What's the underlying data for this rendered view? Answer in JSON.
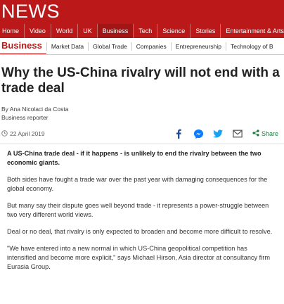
{
  "brand": {
    "logo_text": "NEWS",
    "color": "#bb1919"
  },
  "nav": {
    "items": [
      {
        "label": "Home"
      },
      {
        "label": "Video"
      },
      {
        "label": "World"
      },
      {
        "label": "UK"
      },
      {
        "label": "Business",
        "active": true
      },
      {
        "label": "Tech"
      },
      {
        "label": "Science"
      },
      {
        "label": "Stories"
      },
      {
        "label": "Entertainment & Arts"
      }
    ]
  },
  "subnav": {
    "section": "Business",
    "items": [
      {
        "label": "Market Data"
      },
      {
        "label": "Global Trade"
      },
      {
        "label": "Companies"
      },
      {
        "label": "Entrepreneurship"
      },
      {
        "label": "Technology of B"
      }
    ]
  },
  "article": {
    "headline": "Why the US-China rivalry will not end with a trade deal",
    "author": "By Ana Nicolaci da Costa",
    "role": "Business reporter",
    "date": "22 April 2019",
    "share_label": "Share",
    "share_icons": [
      "facebook-icon",
      "messenger-icon",
      "twitter-icon",
      "email-icon"
    ],
    "paragraphs": [
      "A US-China trade deal - if it happens - is unlikely to end the rivalry between the two economic giants.",
      "Both sides have fought a trade war over the past year with damaging consequences for the global economy.",
      "But many say their dispute goes well beyond trade - it represents a power-struggle between two very different world views.",
      "Deal or no deal, that rivalry is only expected to broaden and become more difficult to resolve.",
      "\"We have entered into a new normal in which US-China geopolitical competition has intensified and become more explicit,\" says Michael Hirson, Asia director at consultancy firm Eurasia Group."
    ]
  }
}
